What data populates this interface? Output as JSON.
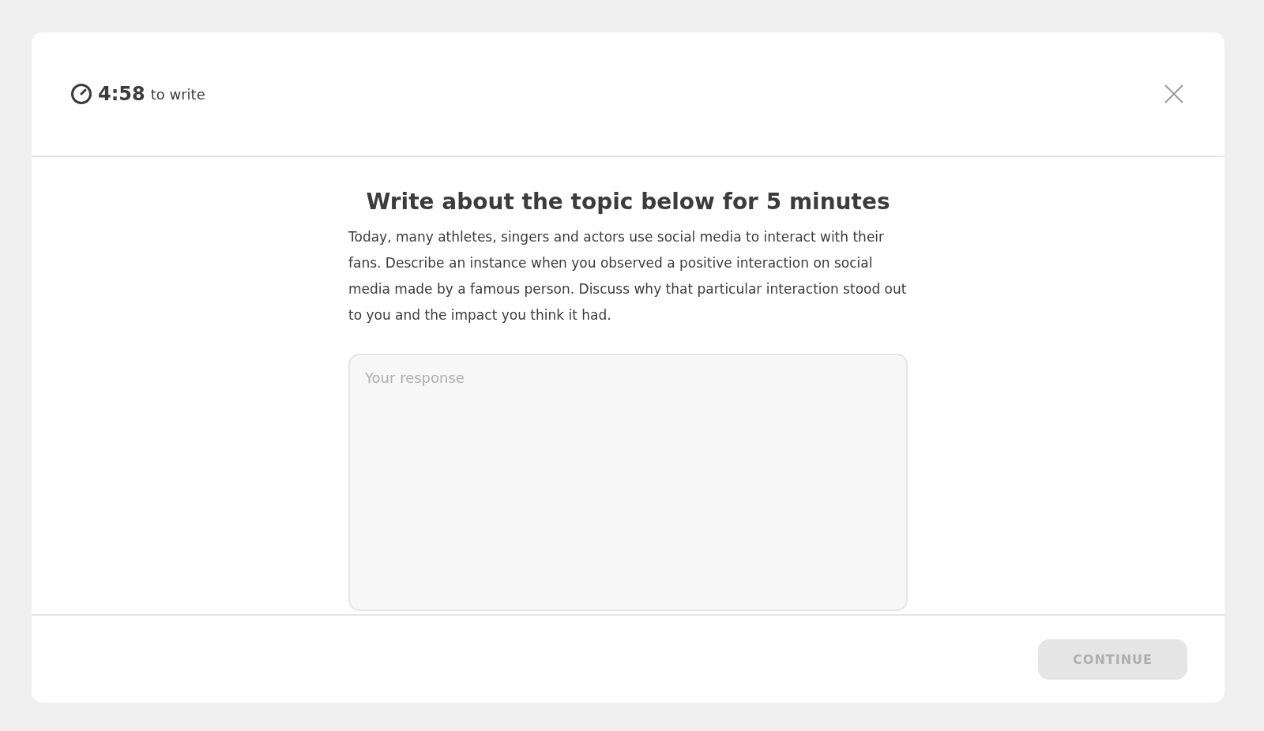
{
  "header": {
    "timer": "4:58",
    "timer_suffix": "to write"
  },
  "prompt": {
    "title": "Write about the topic below for 5 minutes",
    "text": "Today, many athletes, singers and actors use social media to interact with their fans. Describe an instance when you observed a positive interaction on social media made by a famous person. Discuss why that particular interaction stood out to you and the impact you think it had."
  },
  "response": {
    "placeholder": "Your response"
  },
  "footer": {
    "button": {
      "label": "CONTINUE",
      "disabled": true
    }
  }
}
